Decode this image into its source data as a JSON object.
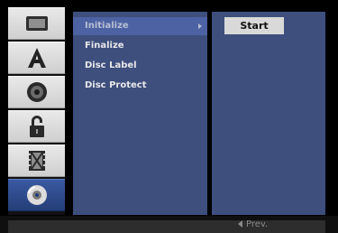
{
  "sidebar": {
    "icons": [
      "tv-icon",
      "letter-a-icon",
      "speaker-icon",
      "padlock-icon",
      "film-icon",
      "disc-icon"
    ],
    "selected_index": 5
  },
  "menu": {
    "items": [
      {
        "label": "Initialize"
      },
      {
        "label": "Finalize"
      },
      {
        "label": "Disc Label"
      },
      {
        "label": "Disc Protect"
      }
    ],
    "highlighted_index": 0
  },
  "submenu": {
    "start_label": "Start"
  },
  "footer": {
    "prev_label": "Prev."
  },
  "colors": {
    "panel": "#3e4f7e",
    "highlight": "#4c62a3",
    "selected_rail": "#243e78"
  }
}
